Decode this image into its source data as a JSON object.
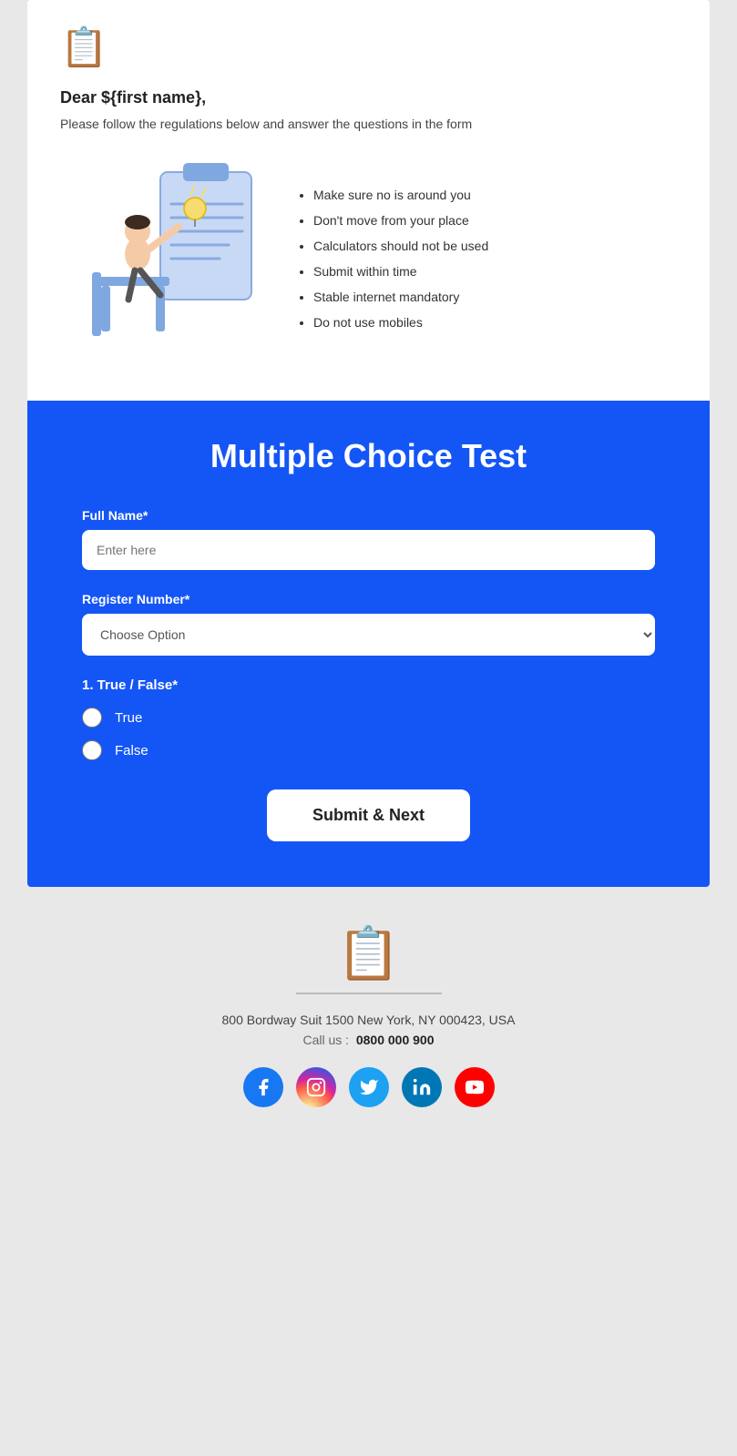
{
  "header": {
    "logo_icon": "📋",
    "greeting": "Dear ${first name},",
    "subtext": "Please follow the regulations below and answer the questions in the form"
  },
  "rules": {
    "items": [
      "Make sure no is around you",
      "Don't move from your place",
      "Calculators should not be used",
      "Submit within time",
      "Stable internet mandatory",
      "Do not use mobiles"
    ]
  },
  "form": {
    "title": "Multiple Choice Test",
    "fullname_label": "Full Name*",
    "fullname_placeholder": "Enter here",
    "register_label": "Register Number*",
    "register_placeholder": "Choose Option",
    "question1_label": "1. True / False*",
    "option_true": "True",
    "option_false": "False",
    "submit_label": "Submit & Next"
  },
  "footer": {
    "logo_icon": "📋",
    "address": "800 Bordway Suit 1500 New York, NY 000423, USA",
    "call_prefix": "Call us :",
    "phone": "0800 000 900"
  },
  "social": {
    "facebook_label": "f",
    "instagram_label": "📷",
    "twitter_label": "🐦",
    "linkedin_label": "in",
    "youtube_label": "▶"
  }
}
